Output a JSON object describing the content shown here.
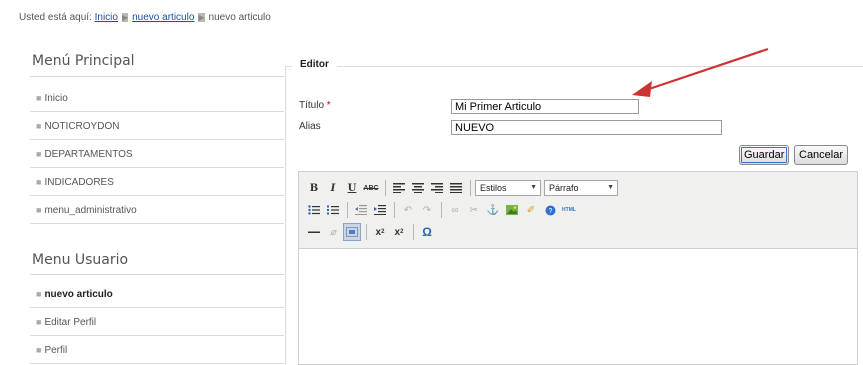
{
  "breadcrumb": {
    "prefix": "Usted está aquí:",
    "items": [
      "Inicio",
      "nuevo articulo",
      "nuevo articulo"
    ]
  },
  "menu_principal": {
    "title": "Menú Principal",
    "items": [
      "Inicio",
      "NOTICROYDON",
      "DEPARTAMENTOS",
      "INDICADORES",
      "menu_administrativo"
    ]
  },
  "menu_usuario": {
    "title": "Menu Usuario",
    "items": [
      "nuevo articulo",
      "Editar Perfil",
      "Perfil"
    ],
    "active": "nuevo articulo"
  },
  "form": {
    "legend": "Editor",
    "title_label": "Título",
    "required_mark": "*",
    "title_value": "Mi Primer Articulo",
    "alias_label": "Alias",
    "alias_value": "NUEVO",
    "save_label": "Guardar",
    "cancel_label": "Cancelar"
  },
  "editor": {
    "styles_select": "Estilos",
    "format_select": "Párrafo",
    "content": ""
  },
  "colors": {
    "link": "#1f4fa3",
    "arrow": "#cc3333",
    "required": "#cc0000"
  },
  "icons": [
    "bold-icon",
    "italic-icon",
    "underline-icon",
    "strikethrough-icon",
    "align-left-icon",
    "align-center-icon",
    "align-right-icon",
    "align-justify-icon",
    "bullet-list-icon",
    "numbered-list-icon",
    "outdent-icon",
    "indent-icon",
    "undo-icon",
    "redo-icon",
    "link-icon",
    "unlink-icon",
    "anchor-icon",
    "image-icon",
    "cleanup-icon",
    "help-icon",
    "html-icon",
    "horizontal-rule-icon",
    "remove-format-icon",
    "visual-aid-icon",
    "subscript-icon",
    "superscript-icon",
    "special-char-icon"
  ]
}
